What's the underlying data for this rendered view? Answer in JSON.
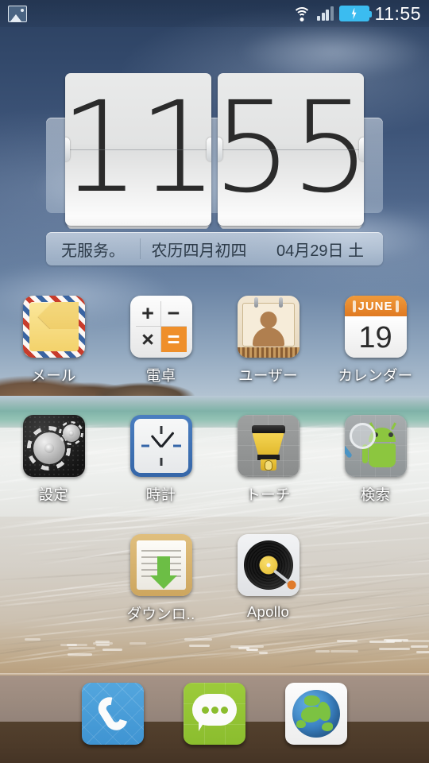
{
  "statusbar": {
    "left_icons": [
      {
        "name": "image-notification-icon",
        "glyph": "image"
      }
    ],
    "right_icons": [
      {
        "name": "wifi-icon",
        "glyph": "wifi"
      },
      {
        "name": "signal-icon",
        "glyph": "signal-bars"
      },
      {
        "name": "battery-charging-icon",
        "glyph": "battery-bolt"
      }
    ],
    "clock": "11:55"
  },
  "clock_widget": {
    "hours": "11",
    "minutes": "55",
    "carrier": "无服务。",
    "lunar_date": "农历四月初四",
    "date": "04月29日 土"
  },
  "apps": [
    [
      {
        "label": "メール",
        "icon": "mail-icon"
      },
      {
        "label": "電卓",
        "icon": "calculator-icon",
        "keys": [
          "+",
          "−",
          "×",
          "="
        ]
      },
      {
        "label": "ユーザー",
        "icon": "contacts-icon"
      },
      {
        "label": "カレンダー",
        "icon": "calendar-icon",
        "month": "JUNE",
        "day": "19"
      }
    ],
    [
      {
        "label": "設定",
        "icon": "settings-gear-icon"
      },
      {
        "label": "時計",
        "icon": "clock-icon"
      },
      {
        "label": "トーチ",
        "icon": "flashlight-icon"
      },
      {
        "label": "検索",
        "icon": "search-icon"
      }
    ],
    [
      {
        "label": "ダウンロ..",
        "icon": "downloads-icon"
      },
      {
        "label": "Apollo",
        "icon": "apollo-music-icon"
      }
    ]
  ],
  "dock": [
    {
      "label": "phone",
      "icon": "phone-icon"
    },
    {
      "label": "messaging",
      "icon": "message-bubble-icon"
    },
    {
      "label": "browser",
      "icon": "globe-browser-icon"
    }
  ],
  "colors": {
    "accent_orange": "#ef8f2a",
    "accent_blue": "#3bbcf0",
    "green": "#8cc63f",
    "dock_upper": "#9b8a7e",
    "dock_lower": "#4c3a29",
    "sky_top": "#2b4060"
  }
}
